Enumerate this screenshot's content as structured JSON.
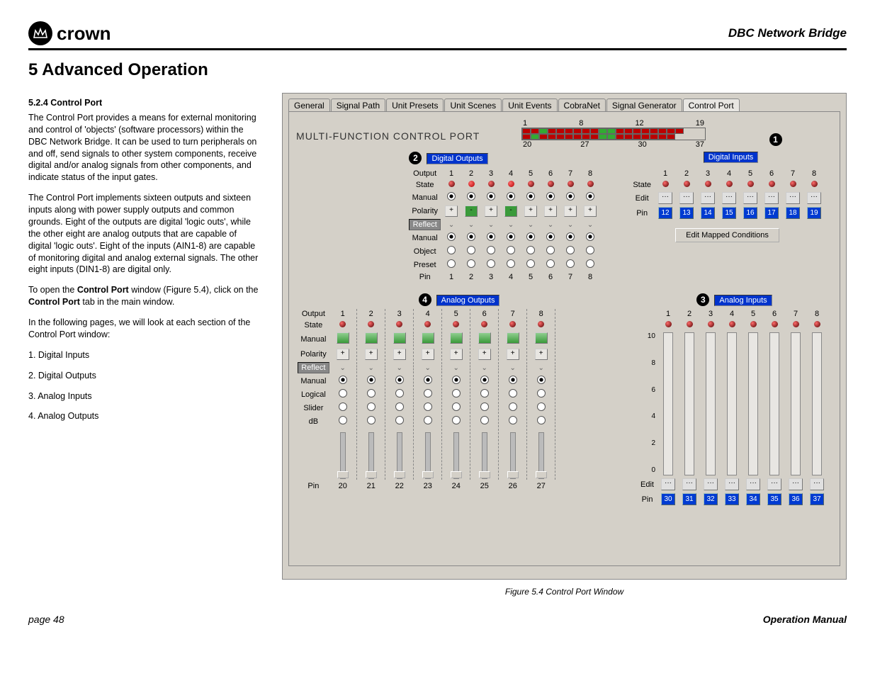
{
  "header": {
    "brand": "crown",
    "doc_right": "DBC Network Bridge"
  },
  "section_title": "5 Advanced Operation",
  "body": {
    "h": "5.2.4 Control Port",
    "p1": "The Control Port provides a means for external monitoring and control of 'objects' (software processors) within the DBC Network Bridge. It can be used to turn peripherals on and off, send signals to other system components, receive digital and/or analog signals from other components, and indicate status of the input gates.",
    "p2": "The Control Port implements sixteen outputs and sixteen inputs along with power supply outputs and common grounds. Eight of the outputs are digital 'logic outs', while the other eight are analog outputs that are capable of digital 'logic outs'. Eight of the inputs (AIN1-8) are capable of monitoring digital and analog external signals. The other eight inputs (DIN1-8) are digital only.",
    "p3a": "To open the ",
    "p3b": "Control Port",
    "p3c": " window (Figure 5.4), click on the ",
    "p3d": "Control Port",
    "p3e": " tab in the main window.",
    "p4": "In the following pages, we will look at each section of the Control Port window:",
    "list": [
      "1. Digital Inputs",
      "2. Digital Outputs",
      "3. Analog Inputs",
      "4. Analog Outputs"
    ]
  },
  "window": {
    "tabs": [
      "General",
      "Signal Path",
      "Unit Presets",
      "Unit Scenes",
      "Unit Events",
      "CobraNet",
      "Signal Generator",
      "Control Port"
    ],
    "active_tab": 7,
    "mfcp": "MULTI-FUNCTION CONTROL PORT",
    "topscale_upper": [
      "1",
      "8",
      "12",
      "19"
    ],
    "topscale_lower": [
      "20",
      "27",
      "30",
      "37"
    ],
    "port_colors_top": [
      "#b00",
      "#b00",
      "#3a3",
      "#b00",
      "#b00",
      "#b00",
      "#b00",
      "#b00",
      "#b00",
      "#3a3",
      "#3a3",
      "#b00",
      "#b00",
      "#b00",
      "#b00",
      "#b00",
      "#b00",
      "#b00",
      "#b00"
    ],
    "port_colors_bottom": [
      "#b00",
      "#3a3",
      "#b00",
      "#b00",
      "#b00",
      "#b00",
      "#b00",
      "#b00",
      "#b00",
      "#3a3",
      "#3a3",
      "#b00",
      "#b00",
      "#b00",
      "#b00",
      "#b00",
      "#b00",
      "#b00"
    ],
    "callouts": {
      "c1": "1",
      "c2": "2",
      "c3": "3",
      "c4": "4"
    },
    "labels": {
      "digital_outputs": "Digital Outputs",
      "digital_inputs": "Digital Inputs",
      "analog_outputs": "Analog Outputs",
      "analog_inputs": "Analog Inputs",
      "edit_mapped": "Edit Mapped Conditions"
    },
    "dig_out": {
      "rows": [
        "Output",
        "State",
        "Manual",
        "Polarity",
        "Reflect",
        "Manual",
        "Object",
        "Preset",
        "Pin"
      ],
      "cols": [
        "1",
        "2",
        "3",
        "4",
        "5",
        "6",
        "7",
        "8"
      ],
      "polarity": [
        "+",
        "-",
        "+",
        "-",
        "+",
        "+",
        "+",
        "+"
      ],
      "state_hot": [
        false,
        true,
        false,
        true,
        false,
        false,
        false,
        false
      ]
    },
    "dig_in": {
      "cols": [
        "1",
        "2",
        "3",
        "4",
        "5",
        "6",
        "7",
        "8"
      ],
      "rows": [
        "State",
        "Edit",
        "Pin"
      ],
      "pins": [
        "12",
        "13",
        "14",
        "15",
        "16",
        "17",
        "18",
        "19"
      ]
    },
    "ana_out": {
      "rows": [
        "Output",
        "State",
        "Manual",
        "Polarity",
        "Reflect",
        "Manual",
        "Logical",
        "Slider",
        "dB"
      ],
      "cols": [
        "1",
        "2",
        "3",
        "4",
        "5",
        "6",
        "7",
        "8"
      ],
      "pins": [
        "20",
        "21",
        "22",
        "23",
        "24",
        "25",
        "26",
        "27"
      ]
    },
    "ana_in": {
      "cols": [
        "1",
        "2",
        "3",
        "4",
        "5",
        "6",
        "7",
        "8"
      ],
      "yaxis": [
        "10",
        "8",
        "6",
        "4",
        "2",
        "0"
      ],
      "rows_bottom": [
        "Edit",
        "Pin"
      ],
      "pins": [
        "30",
        "31",
        "32",
        "33",
        "34",
        "35",
        "36",
        "37"
      ]
    }
  },
  "figcaption": "Figure 5.4  Control Port Window",
  "footer": {
    "left": "page 48",
    "right": "Operation Manual"
  }
}
